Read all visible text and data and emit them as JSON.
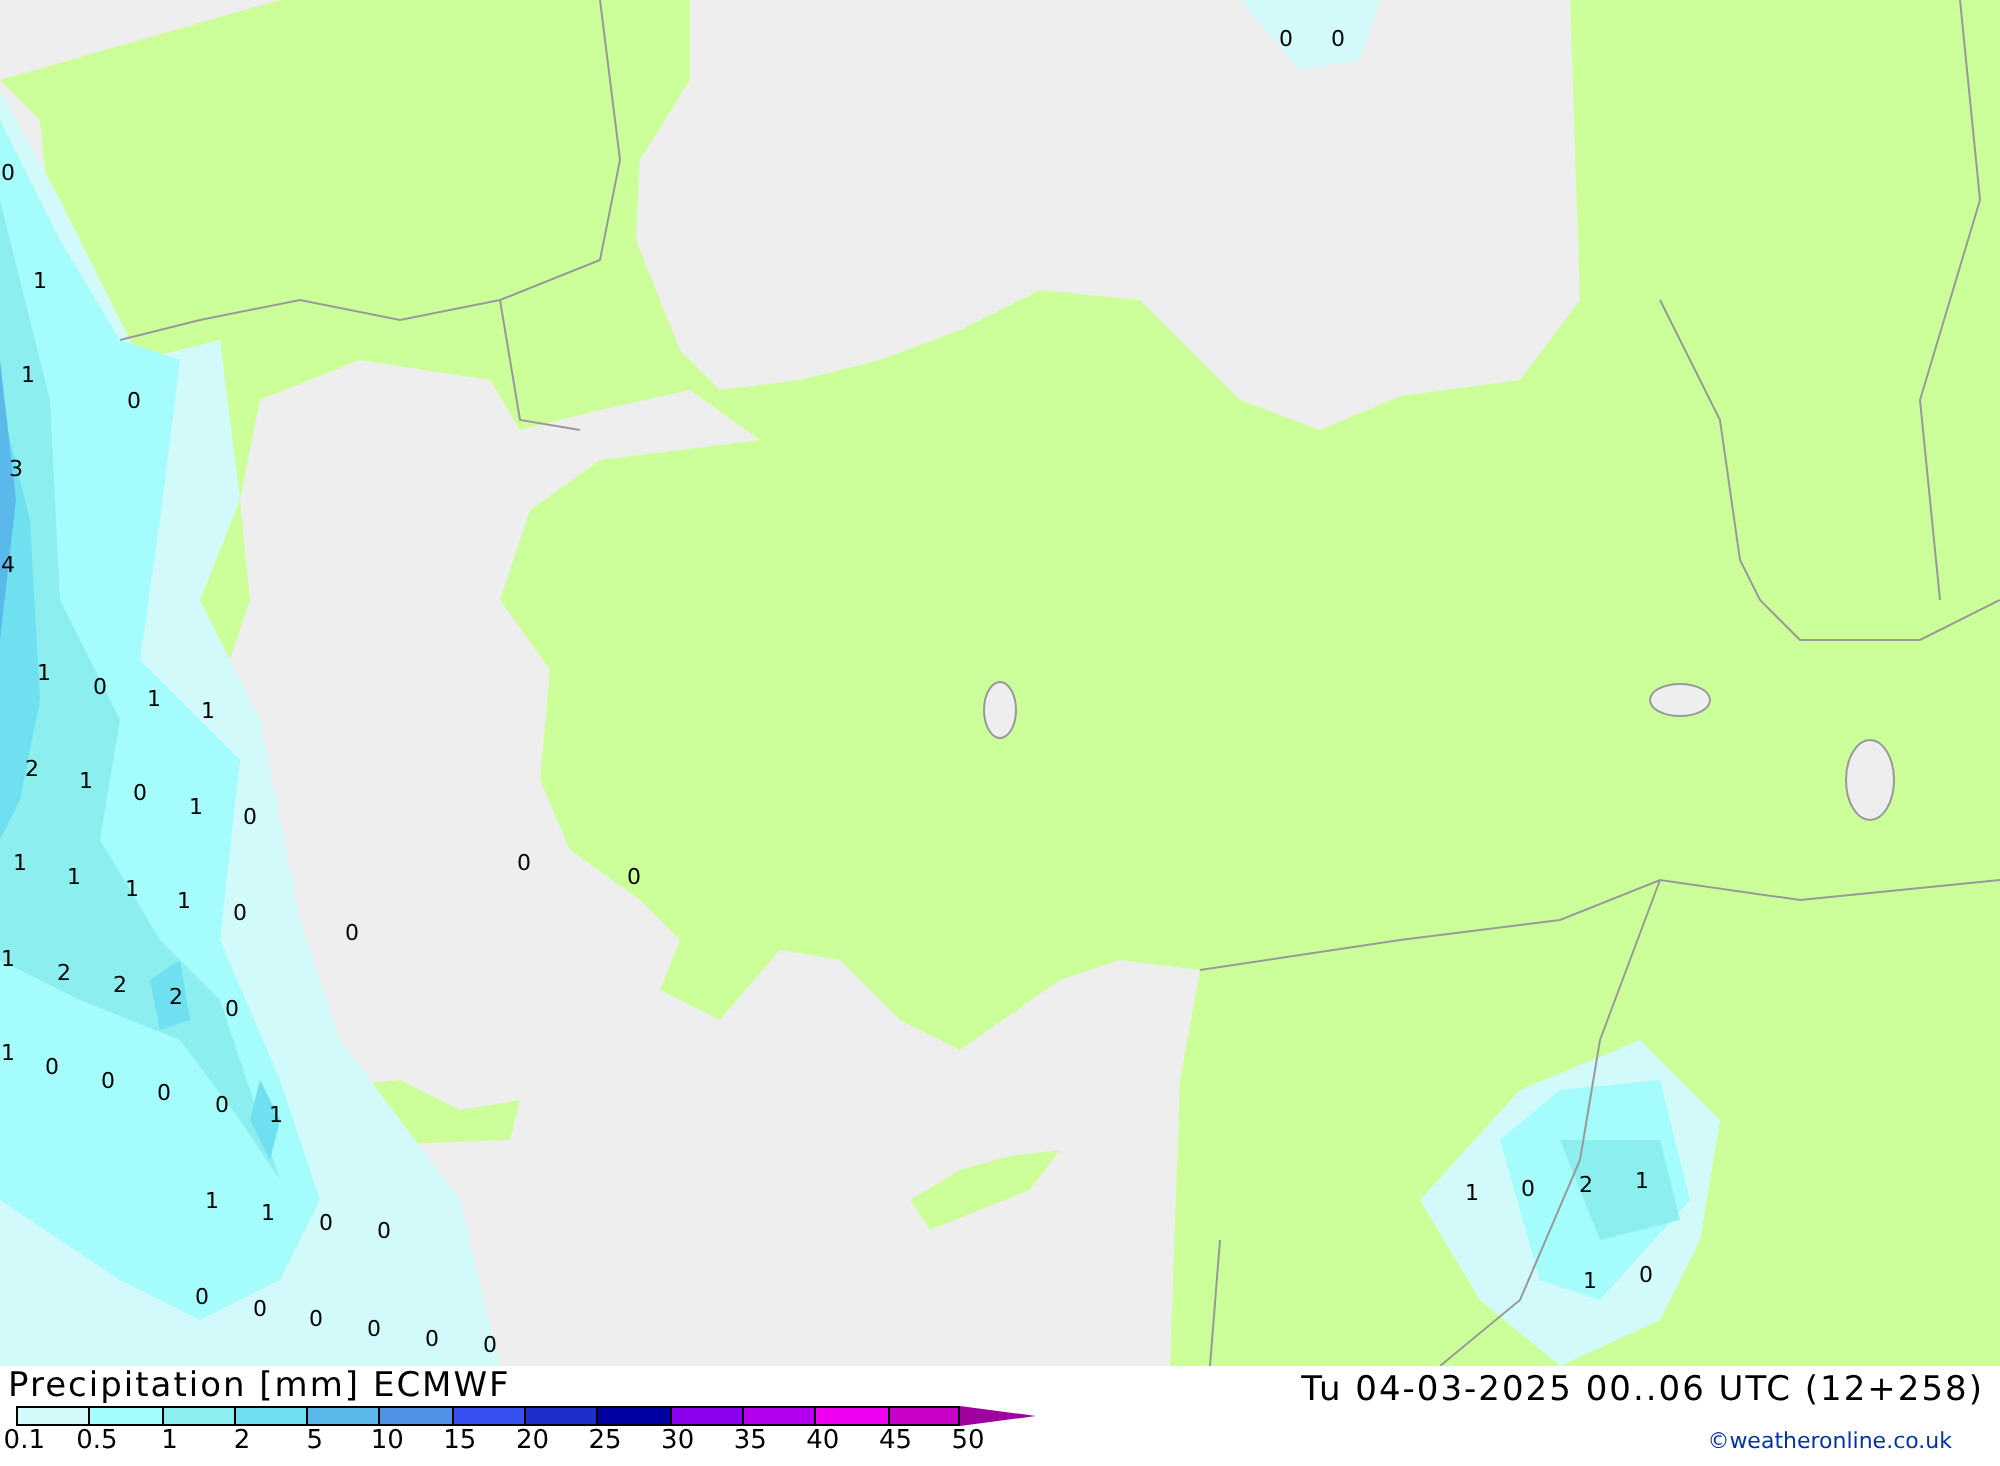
{
  "map": {
    "labels": [
      "0",
      "0",
      "0",
      "1",
      "1",
      "0",
      "3",
      "4",
      "1",
      "0",
      "1",
      "1",
      "2",
      "1",
      "0",
      "1",
      "0",
      "1",
      "1",
      "1",
      "1",
      "0",
      "0",
      "0",
      "0",
      "1",
      "2",
      "2",
      "2",
      "0",
      "1",
      "0",
      "0",
      "0",
      "0",
      "1",
      "1",
      "1",
      "0",
      "0",
      "0",
      "0",
      "0",
      "0",
      "0",
      "0",
      "1",
      "0",
      "2",
      "1",
      "1",
      "0"
    ]
  },
  "legend": {
    "title": "Precipitation [mm] ECMWF",
    "swatches": [
      {
        "color": "#d2fafa"
      },
      {
        "color": "#a5fcfc"
      },
      {
        "color": "#8ceeee"
      },
      {
        "color": "#6ee0f0"
      },
      {
        "color": "#5ab9ea"
      },
      {
        "color": "#5091e8"
      },
      {
        "color": "#3750f0"
      },
      {
        "color": "#1e2ec8"
      },
      {
        "color": "#0000a0"
      },
      {
        "color": "#8c00f0"
      },
      {
        "color": "#b400f0"
      },
      {
        "color": "#f000f0"
      },
      {
        "color": "#c800c8"
      }
    ],
    "arrow": {
      "color": "#a000a0"
    },
    "ticks": [
      "0.1",
      "0.5",
      "1",
      "2",
      "5",
      "10",
      "15",
      "20",
      "25",
      "30",
      "35",
      "40",
      "45",
      "50"
    ]
  },
  "valid_time": "Tu 04-03-2025 00..06 UTC (12+258)",
  "credit": "©weatheronline.co.uk"
}
